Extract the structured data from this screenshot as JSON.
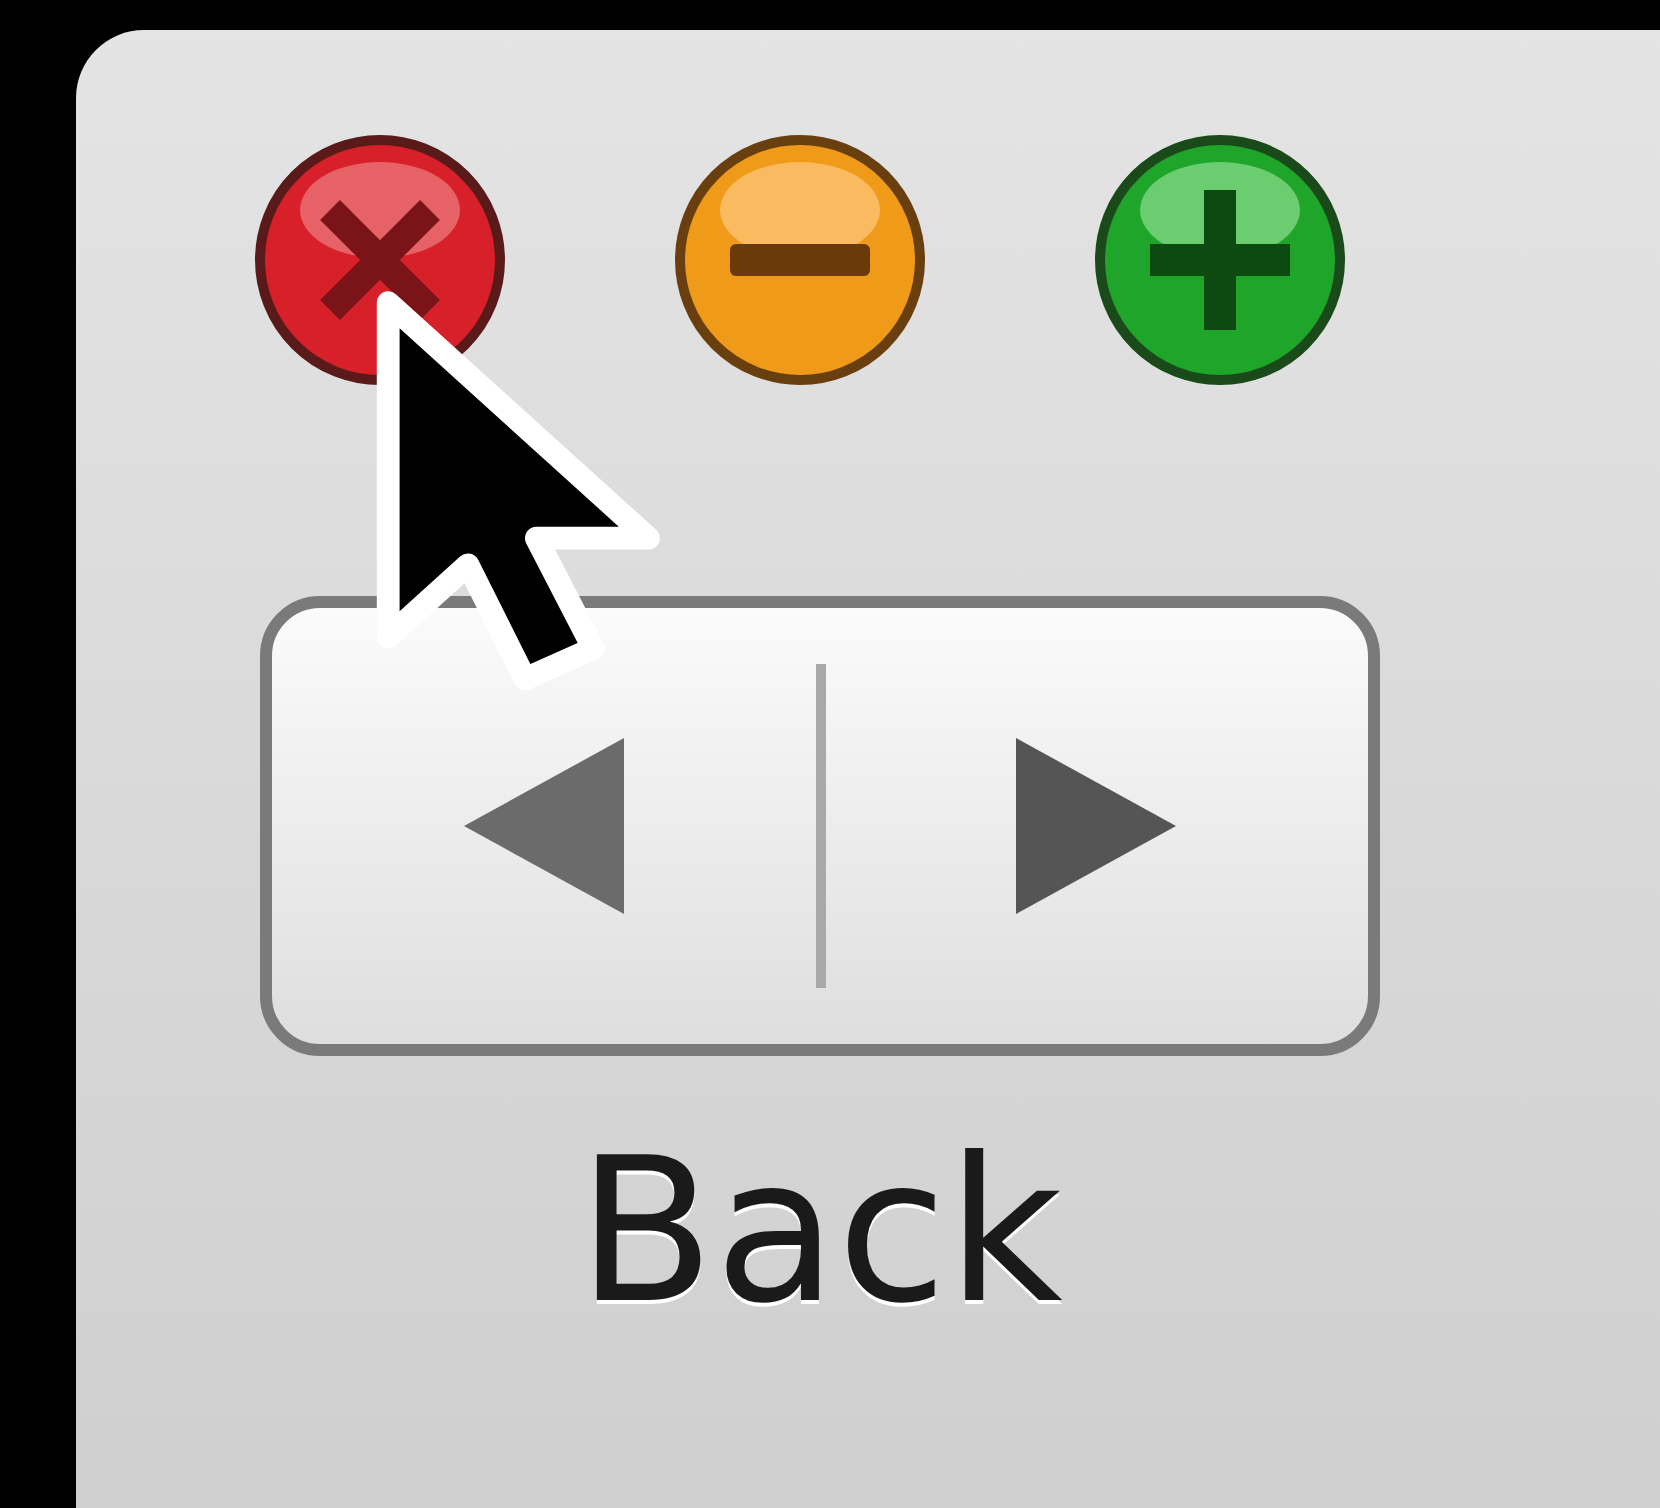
{
  "toolbar": {
    "navigation": {
      "label": "Back"
    }
  }
}
